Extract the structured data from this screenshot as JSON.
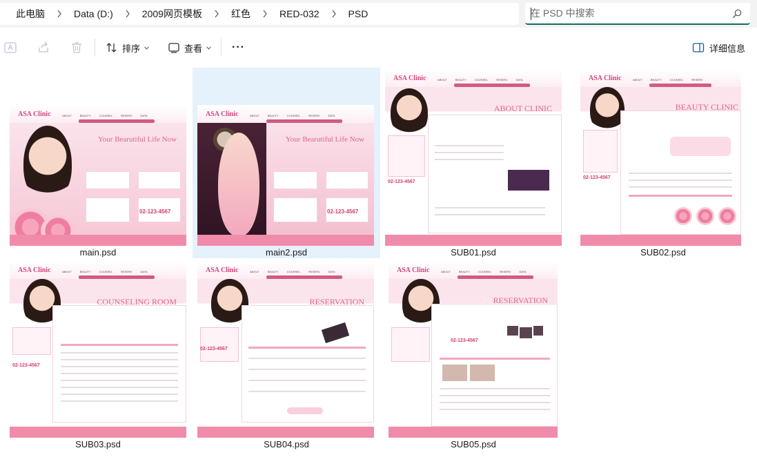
{
  "breadcrumbs": [
    "此电脑",
    "Data (D:)",
    "2009网页模板",
    "红色",
    "RED-032",
    "PSD"
  ],
  "search": {
    "placeholder": "在 PSD 中搜索"
  },
  "toolbar": {
    "sort_label": "排序",
    "view_label": "查看",
    "more_label": "···",
    "details_label": "详细信息"
  },
  "files": [
    {
      "name": "main.psd",
      "selected": false
    },
    {
      "name": "main2.psd",
      "selected": true
    },
    {
      "name": "SUB01.psd",
      "selected": false
    },
    {
      "name": "SUB02.psd",
      "selected": false
    },
    {
      "name": "SUB03.psd",
      "selected": false
    },
    {
      "name": "SUB04.psd",
      "selected": false
    },
    {
      "name": "SUB05.psd",
      "selected": false
    }
  ],
  "thumb_text": {
    "logo": "ASA Clinic",
    "nav": [
      "ABOUT CLINIC",
      "BEAUTY CLINIC",
      "COUNSELING",
      "RESERVATION",
      "DATA ROOM"
    ],
    "main_title": "Your Bearutiful Life Now",
    "main2_title": "Your Bearutiful Life Now",
    "sub01_title": "ABOUT CLINIC",
    "sub02_title": "BEAUTY CLINIC",
    "sub03_title": "COUNSELING ROOM",
    "sub04_title": "RESERVATION",
    "sub05_title": "RESERVATION",
    "phone": "02-123-4567"
  },
  "colors": {
    "accent": "#0f6b5c",
    "selected_bg": "#e5f1fb",
    "thumb_pink": "#f6c6d4"
  }
}
